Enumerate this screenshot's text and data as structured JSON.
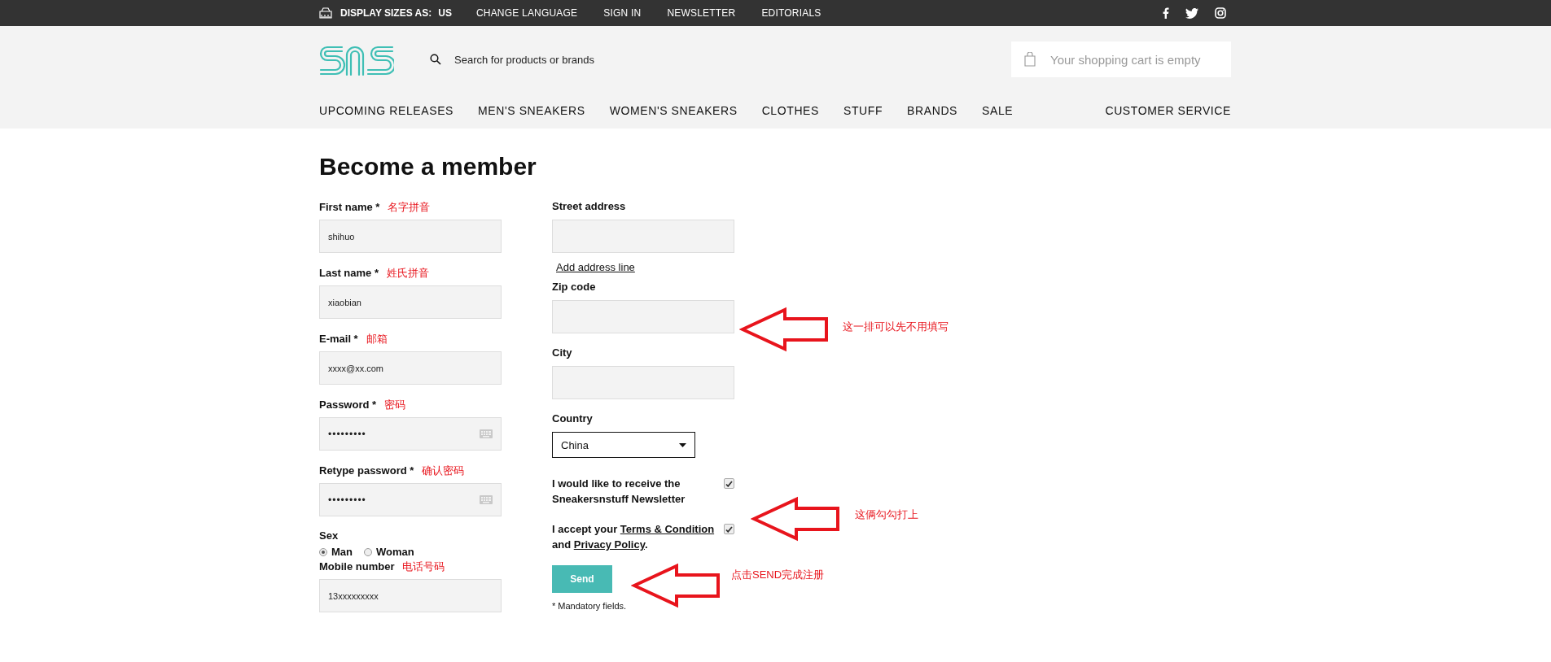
{
  "top_bar": {
    "display_sizes_label": "DISPLAY SIZES AS:",
    "display_sizes_value": "US",
    "links": [
      "CHANGE LANGUAGE",
      "SIGN IN",
      "NEWSLETTER",
      "EDITORIALS"
    ]
  },
  "header": {
    "search_placeholder": "Search for products or brands",
    "cart": "Your shopping cart is empty"
  },
  "nav": {
    "items": [
      "UPCOMING RELEASES",
      "MEN'S SNEAKERS",
      "WOMEN'S SNEAKERS",
      "CLOTHES",
      "STUFF",
      "BRANDS",
      "SALE"
    ],
    "customer_service": "CUSTOMER SERVICE"
  },
  "form": {
    "title": "Become a member",
    "left": [
      {
        "kind": "text",
        "label": "First name *",
        "note": "名字拼音",
        "value": "shihuo"
      },
      {
        "kind": "text",
        "label": "Last name *",
        "note": "姓氏拼音",
        "value": "xiaobian"
      },
      {
        "kind": "text",
        "label": "E-mail *",
        "note": "邮箱",
        "value": "xxxx@xx.com"
      },
      {
        "kind": "password",
        "label": "Password *",
        "note": "密码",
        "value": "•••••••••"
      },
      {
        "kind": "password",
        "label": "Retype password *",
        "note": "确认密码",
        "value": "•••••••••"
      },
      {
        "kind": "radio",
        "label": "Sex",
        "options": [
          {
            "label": "Man",
            "selected": true
          },
          {
            "label": "Woman",
            "selected": false
          }
        ]
      },
      {
        "kind": "text",
        "label": "Mobile number",
        "note": "电话号码",
        "value": "13xxxxxxxxx"
      }
    ],
    "street_address": {
      "label": "Street address"
    },
    "add_address_line": "Add address line",
    "zip_code": {
      "label": "Zip code"
    },
    "city": {
      "label": "City"
    },
    "country": {
      "label": "Country",
      "value": "China"
    },
    "checkboxes": [
      {
        "checked": true,
        "parts": [
          {
            "text": "I would like to receive the Sneakersnstuff Newsletter",
            "kind": "text"
          }
        ]
      },
      {
        "checked": true,
        "parts": [
          {
            "text": "I accept your ",
            "kind": "text"
          },
          {
            "text": "Terms & Condition",
            "kind": "link"
          },
          {
            "text": " and ",
            "kind": "text"
          },
          {
            "text": "Privacy Policy",
            "kind": "link"
          },
          {
            "text": ".",
            "kind": "text"
          }
        ]
      }
    ],
    "send": "Send",
    "mandatory_note": "* Mandatory fields."
  },
  "annotations": [
    {
      "text": "这一排可以先不用填写"
    },
    {
      "text": "这俩勾勾打上"
    },
    {
      "text": "点击SEND完成注册"
    }
  ]
}
